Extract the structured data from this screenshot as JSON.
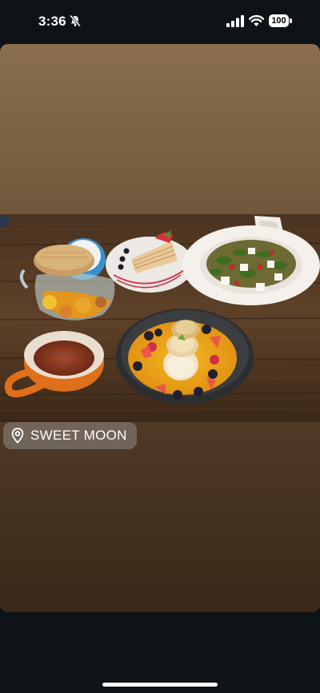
{
  "status_bar": {
    "time": "3:36",
    "battery_level": "100",
    "icons": [
      "bell-slash-icon",
      "cellular-signal-icon",
      "wifi-icon",
      "battery-icon"
    ]
  },
  "story": {
    "location": {
      "icon": "location-pin-icon",
      "name": "SWEET MOON"
    },
    "photo_subject": "food-photo"
  }
}
